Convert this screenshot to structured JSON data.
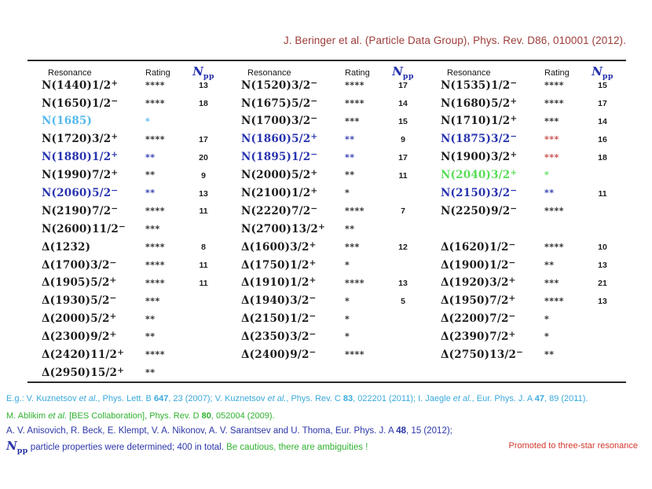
{
  "colors": {
    "maroon": "#9d3c38",
    "black": "#1d1d1d",
    "blue": "#2733ae",
    "cyan": "#53b9ec",
    "green": "#57dd57",
    "red": "#c34343",
    "footer_cyan": "#39a9dd",
    "footer_green": "#2fb22f",
    "footer_navy": "#2b36a9",
    "footer_red": "#d1372b",
    "rule": "#2b2b2b"
  },
  "title": {
    "text": "J. Beringer et al. (Particle Data Group), Phys. Rev. D86, 010001 (2012)."
  },
  "table": {
    "headers": {
      "resonance": "Resonance",
      "rating": "Rating",
      "npp_main": "N",
      "npp_sub": "pp"
    },
    "rows": [
      [
        {
          "res": "N(1440)1/2",
          "sup": "+",
          "stars": "****",
          "n": "13"
        },
        {
          "res": "N(1520)3/2",
          "sup": "−",
          "stars": "****",
          "n": "17"
        },
        {
          "res": "N(1535)1/2",
          "sup": "−",
          "stars": "****",
          "n": "15"
        }
      ],
      [
        {
          "res": "N(1650)1/2",
          "sup": "−",
          "stars": "****",
          "n": "18"
        },
        {
          "res": "N(1675)5/2",
          "sup": "−",
          "stars": "****",
          "n": "14"
        },
        {
          "res": "N(1680)5/2",
          "sup": "+",
          "stars": "****",
          "n": "17"
        }
      ],
      [
        {
          "res": "N(1685)",
          "stars": "*",
          "nc": "cyan",
          "rc": "cyan"
        },
        {
          "res": "N(1700)3/2",
          "sup": "−",
          "stars": "***",
          "n": "15"
        },
        {
          "res": "N(1710)1/2",
          "sup": "+",
          "stars": "***",
          "n": "14"
        }
      ],
      [
        {
          "res": "N(1720)3/2",
          "sup": "+",
          "stars": "****",
          "n": "17"
        },
        {
          "res": "N(1860)5/2",
          "sup": "+",
          "stars": "**",
          "n": "9",
          "nc": "blue",
          "rc": "blue"
        },
        {
          "res": "N(1875)3/2",
          "sup": "−",
          "stars": "***",
          "n": "16",
          "nc": "blue",
          "rc": "red"
        }
      ],
      [
        {
          "res": "N(1880)1/2",
          "sup": "+",
          "stars": "**",
          "n": "20",
          "nc": "blue",
          "rc": "blue"
        },
        {
          "res": "N(1895)1/2",
          "sup": "−",
          "stars": "**",
          "n": "17",
          "nc": "blue",
          "rc": "blue"
        },
        {
          "res": "N(1900)3/2",
          "sup": "+",
          "stars": "***",
          "n": "18",
          "rc": "red"
        }
      ],
      [
        {
          "res": "N(1990)7/2",
          "sup": "+",
          "stars": "**",
          "n": "9"
        },
        {
          "res": "N(2000)5/2",
          "sup": "+",
          "stars": "**",
          "n": "11"
        },
        {
          "res": "N(2040)3/2",
          "sup": "+",
          "stars": "*",
          "nc": "green",
          "rc": "green"
        }
      ],
      [
        {
          "res": "N(2060)5/2",
          "sup": "−",
          "stars": "**",
          "n": "13",
          "nc": "blue",
          "rc": "blue"
        },
        {
          "res": "N(2100)1/2",
          "sup": "+",
          "stars": "*"
        },
        {
          "res": "N(2150)3/2",
          "sup": "−",
          "stars": "**",
          "n": "11",
          "nc": "blue",
          "rc": "blue"
        }
      ],
      [
        {
          "res": "N(2190)7/2",
          "sup": "−",
          "stars": "****",
          "n": "11"
        },
        {
          "res": "N(2220)7/2",
          "sup": "−",
          "stars": "****",
          "n": "7"
        },
        {
          "res": "N(2250)9/2",
          "sup": "−",
          "stars": "****"
        }
      ],
      [
        {
          "res": "N(2600)11/2",
          "sup": "−",
          "stars": "***"
        },
        {
          "res": "N(2700)13/2",
          "sup": "+",
          "stars": "**"
        },
        null
      ],
      [
        {
          "res": "Δ(1232)",
          "stars": "****",
          "n": "8"
        },
        {
          "res": "Δ(1600)3/2",
          "sup": "+",
          "stars": "***",
          "n": "12"
        },
        {
          "res": "Δ(1620)1/2",
          "sup": "−",
          "stars": "****",
          "n": "10"
        }
      ],
      [
        {
          "res": "Δ(1700)3/2",
          "sup": "−",
          "stars": "****",
          "n": "11"
        },
        {
          "res": "Δ(1750)1/2",
          "sup": "+",
          "stars": "*"
        },
        {
          "res": "Δ(1900)1/2",
          "sup": "−",
          "stars": "**",
          "n": "13"
        }
      ],
      [
        {
          "res": "Δ(1905)5/2",
          "sup": "+",
          "stars": "****",
          "n": "11"
        },
        {
          "res": "Δ(1910)1/2",
          "sup": "+",
          "stars": "****",
          "n": "13"
        },
        {
          "res": "Δ(1920)3/2",
          "sup": "+",
          "stars": "***",
          "n": "21"
        }
      ],
      [
        {
          "res": "Δ(1930)5/2",
          "sup": "−",
          "stars": "***"
        },
        {
          "res": "Δ(1940)3/2",
          "sup": "−",
          "stars": "*",
          "n": "5"
        },
        {
          "res": "Δ(1950)7/2",
          "sup": "+",
          "stars": "****",
          "n": "13"
        }
      ],
      [
        {
          "res": "Δ(2000)5/2",
          "sup": "+",
          "stars": "**"
        },
        {
          "res": "Δ(2150)1/2",
          "sup": "−",
          "stars": "*"
        },
        {
          "res": "Δ(2200)7/2",
          "sup": "−",
          "stars": "*"
        }
      ],
      [
        {
          "res": "Δ(2300)9/2",
          "sup": "+",
          "stars": "**"
        },
        {
          "res": "Δ(2350)3/2",
          "sup": "−",
          "stars": "*"
        },
        {
          "res": "Δ(2390)7/2",
          "sup": "+",
          "stars": "*"
        }
      ],
      [
        {
          "res": "Δ(2420)11/2",
          "sup": "+",
          "stars": "****"
        },
        {
          "res": "Δ(2400)9/2",
          "sup": "−",
          "stars": "****"
        },
        {
          "res": "Δ(2750)13/2",
          "sup": "−",
          "stars": "**"
        }
      ],
      [
        {
          "res": "Δ(2950)15/2",
          "sup": "+",
          "stars": "**"
        },
        null,
        null
      ]
    ]
  },
  "footer": {
    "line1": [
      {
        "t": "E.g.: V. Kuznetsov "
      },
      {
        "t": "et al.",
        "i": true
      },
      {
        "t": ", Phys. Lett. B "
      },
      {
        "t": "647",
        "b": true
      },
      {
        "t": ", 23 (2007); V. Kuznetsov "
      },
      {
        "t": "et al.",
        "i": true
      },
      {
        "t": ", Phys. Rev. C "
      },
      {
        "t": "83",
        "b": true
      },
      {
        "t": ", 022201 (2011); I. Jaegle "
      },
      {
        "t": "et al.",
        "i": true
      },
      {
        "t": ", Eur. Phys. J. A "
      },
      {
        "t": "47",
        "b": true
      },
      {
        "t": ", 89 (2011)."
      }
    ],
    "line2": [
      {
        "t": "M. Ablikim "
      },
      {
        "t": "et al.",
        "i": true
      },
      {
        "t": " [BES Collaboration], Phys. Rev. D "
      },
      {
        "t": "80",
        "b": true
      },
      {
        "t": ", 052004 (2009)."
      }
    ],
    "line3": [
      {
        "t": "A. V. Anisovich, R. Beck, E. Klempt, V. A. Nikonov, A. V. Sarantsev and U. Thoma, Eur. Phys. J. A "
      },
      {
        "t": "48",
        "b": true
      },
      {
        "t": ", 15 (2012);"
      }
    ],
    "line4": {
      "npp_main": "N",
      "npp_sub": "pp",
      "blue_text": " particle properties were determined; 400 in total. ",
      "green_text": "Be cautious, there are ambiguities !",
      "red_text": "Promoted to three-star resonance"
    }
  }
}
